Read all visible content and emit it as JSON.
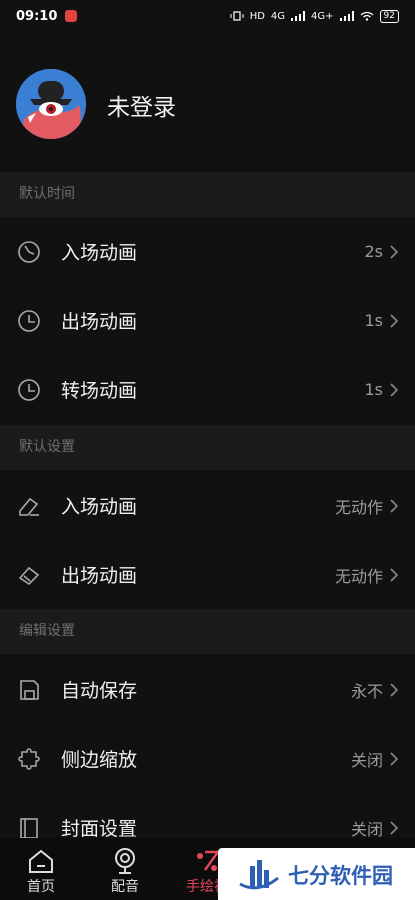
{
  "status_bar": {
    "time": "09:10",
    "network_left": "HD",
    "network_4g_1": "4G",
    "network_4g_2": "4G+",
    "battery": "92"
  },
  "profile": {
    "name": "未登录"
  },
  "sections": {
    "default_time": {
      "title": "默认时间",
      "rows": [
        {
          "label": "入场动画",
          "value": "2s"
        },
        {
          "label": "出场动画",
          "value": "1s"
        },
        {
          "label": "转场动画",
          "value": "1s"
        }
      ]
    },
    "default_settings": {
      "title": "默认设置",
      "rows": [
        {
          "label": "入场动画",
          "value": "无动作"
        },
        {
          "label": "出场动画",
          "value": "无动作"
        }
      ]
    },
    "edit_settings": {
      "title": "编辑设置",
      "rows": [
        {
          "label": "自动保存",
          "value": "永不"
        },
        {
          "label": "侧边缩放",
          "value": "关闭"
        },
        {
          "label": "封面设置",
          "value": "关闭"
        }
      ]
    }
  },
  "tab_bar": {
    "tabs": [
      {
        "label": "首页",
        "icon": "home-icon"
      },
      {
        "label": "配音",
        "icon": "microphone-icon"
      },
      {
        "label": "手绘视",
        "icon": "brush-icon"
      }
    ],
    "active_index": 2
  },
  "watermark": {
    "text": "七分软件园"
  },
  "colors": {
    "background": "#111111",
    "section_header_bg": "#1b1b1b",
    "accent": "#e8465d",
    "avatar_bg": "#3a7fd4"
  }
}
